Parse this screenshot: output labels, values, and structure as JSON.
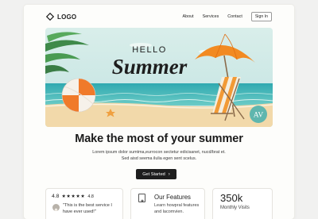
{
  "nav": {
    "logo_text": "LOGO",
    "links": [
      "About",
      "Services",
      "Contact"
    ],
    "signin_label": "Sign In"
  },
  "hero": {
    "title_line1": "HELLO",
    "title_line2": "Summer",
    "badge_text": "AV"
  },
  "headline": "Make the most of your summer",
  "subtext": {
    "line1": "Lorem ipsum dolor sumtma,eurrocon sectetur edicisanet, nucd/brat et.",
    "line2": "Sed aisd seema ilulia egen sent scelus."
  },
  "cta": {
    "label": "Get Started",
    "arrow": "›"
  },
  "cards": {
    "rating": {
      "score": "4.8",
      "stars": "★★★★★",
      "score_small": "4.8",
      "quote": "\"This is the best service I have ever used!\""
    },
    "features": {
      "title": "Our Features",
      "description": "Learn howpral features and lacomvien."
    },
    "stats": {
      "value": "350k",
      "label": "Monthly Visits"
    }
  },
  "colors": {
    "sky": "#cde8e6",
    "sea": "#3fb3b5",
    "sand": "#f1d8a9",
    "umbrella": "#f28a22",
    "ball_orange": "#f07a2a",
    "badge": "#5fb6ae"
  }
}
